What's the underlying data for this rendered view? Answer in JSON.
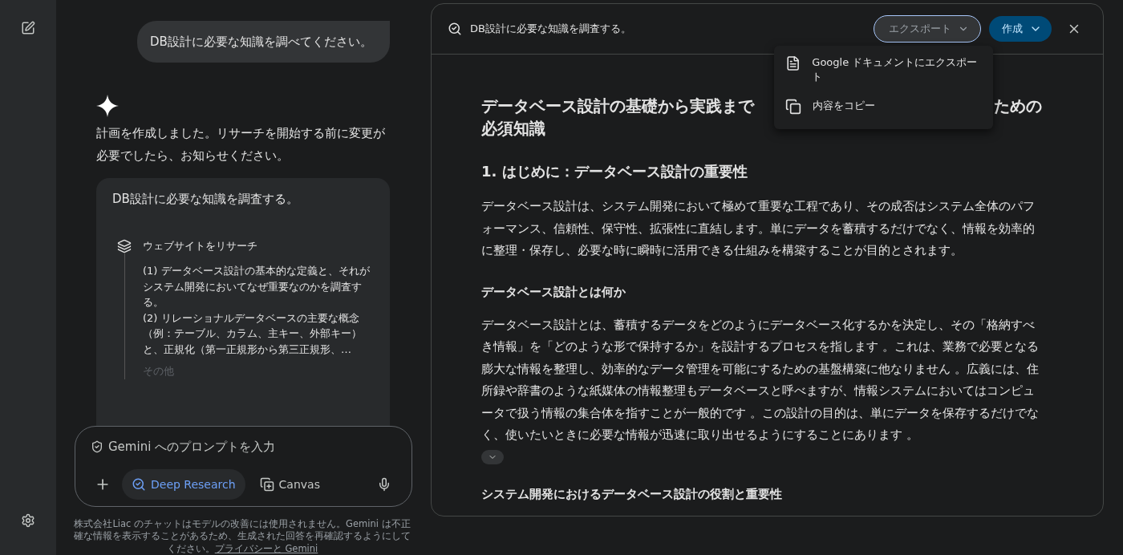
{
  "user_message": "DB設計に必要な知識を調べてください。",
  "assistant_message": "計画を作成しました。リサーチを開始する前に変更が必要でしたら、お知らせください。",
  "plan_card": {
    "title": "DB設計に必要な知識を調査する。",
    "step_title": "ウェブサイトをリサーチ",
    "step_lines": [
      "(1) データベース設計の基本的な定義と、それがシステム開発においてなぜ重要なのかを調査する。",
      "(2) リレーショナルデータベースの主要な概念（例：テーブル、カラム、主キー、外部キー）と、正規化（第一正規形から第三正規形、…"
    ],
    "more": "その他"
  },
  "prompt": {
    "placeholder": "Gemini へのプロンプトを入力",
    "tools": [
      {
        "label": "Deep Research",
        "selected": true
      },
      {
        "label": "Canvas",
        "selected": false
      }
    ]
  },
  "disclaimer": {
    "text": "株式会社Liac のチャットはモデルの改善には使用されません。Gemini は不正確な情報を表示することがあるため、生成された回答を再確認するようにしてください。",
    "link": "プライバシーと Gemini"
  },
  "panel": {
    "title": "DB設計に必要な知識を調査する。",
    "export_button": "エクスポート",
    "create_button": "作成",
    "menu": [
      {
        "kind": "doc",
        "label": "Google ドキュメントにエクスポート"
      },
      {
        "kind": "copy",
        "label": "内容をコピー"
      }
    ],
    "doc_title": {
      "line1_left": "データベース設計の基礎から実践まで",
      "line1_right": "ための",
      "line2": "必須知識"
    },
    "sections": [
      {
        "kind": "h2",
        "text": "1. はじめに：データベース設計の重要性"
      },
      {
        "kind": "p",
        "text": "データベース設計は、システム開発において極めて重要な工程であり、その成否はシステム全体のパフォーマンス、信頼性、保守性、拡張性に直結します。単にデータを蓄積するだけでなく、情報を効率的に整理・保存し、必要な時に瞬時に活用できる仕組みを構築することが目的とされます。"
      },
      {
        "kind": "h3",
        "text": "データベース設計とは何か"
      },
      {
        "kind": "p",
        "text": "データベース設計とは、蓄積するデータをどのようにデータベース化するかを決定し、その「格納すべき情報」を「どのような形で保持するか」を設計するプロセスを指します 。これは、業務で必要となる膨大な情報を整理し、効率的なデータ管理を可能にするための基盤構築に他なりません 。広義には、住所録や辞書のような紙媒体の情報整理もデータベースと呼べますが、情報システムにおいてはコンピュータで扱う情報の集合体を指すことが一般的です 。この設計の目的は、単にデータを保存するだけでなく、使いたいときに必要な情報が迅速に取り出せるようにすることにあります 。",
        "expandable": true
      },
      {
        "kind": "h3",
        "text": "システム開発におけるデータベース設計の役割と重要性"
      }
    ]
  }
}
